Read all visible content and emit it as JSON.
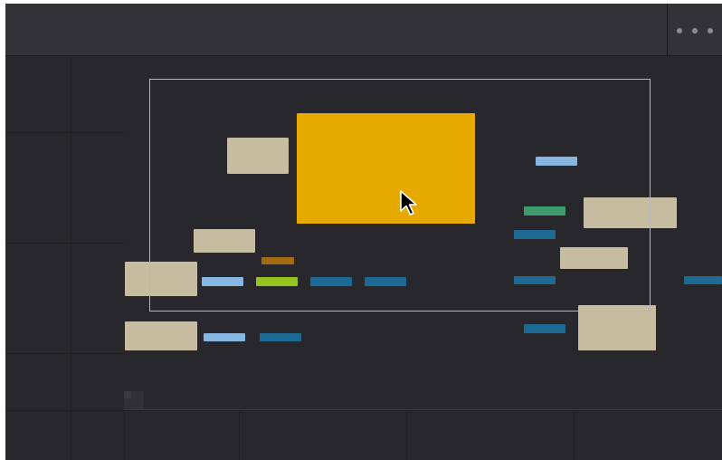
{
  "window": {
    "title": ""
  },
  "toolbar": {
    "more_icon": "more-horizontal-icon"
  },
  "canvas": {
    "node_count": 21,
    "selected_node": "orange-block"
  },
  "colors": {
    "background": "#28282c",
    "titlebar": "#333337",
    "node_beige": "#c6bda1",
    "node_orange": "#e5a900",
    "pill_light_blue": "#88b6e2",
    "pill_blue": "#1d6a94",
    "pill_green": "#3f9c6e",
    "pill_lime": "#94c41d",
    "pill_brown": "#a36a14",
    "viewport_frame": "#b7b7bb"
  },
  "cursor": {
    "icon": "arrow-pointer-icon"
  }
}
